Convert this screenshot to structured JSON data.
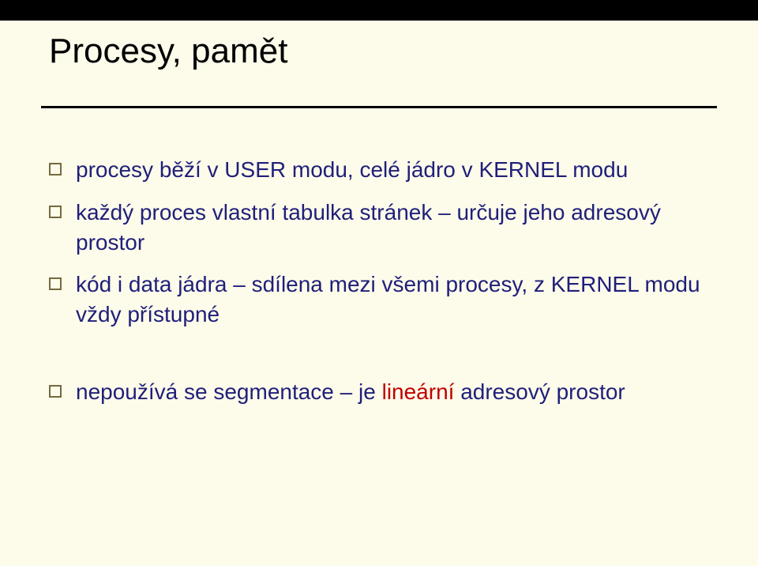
{
  "slide": {
    "title": "Procesy, pamět",
    "bullets": [
      "procesy běží v USER modu, celé jádro v KERNEL modu",
      "každý proces vlastní tabulka stránek – určuje jeho adresový prostor",
      "kód i data jádra – sdílena mezi všemi procesy, z KERNEL modu vždy přístupné"
    ],
    "bullets2": {
      "prefix": "nepoužívá se segmentace – je ",
      "highlight": "lineární",
      "suffix": " adresový prostor"
    }
  }
}
